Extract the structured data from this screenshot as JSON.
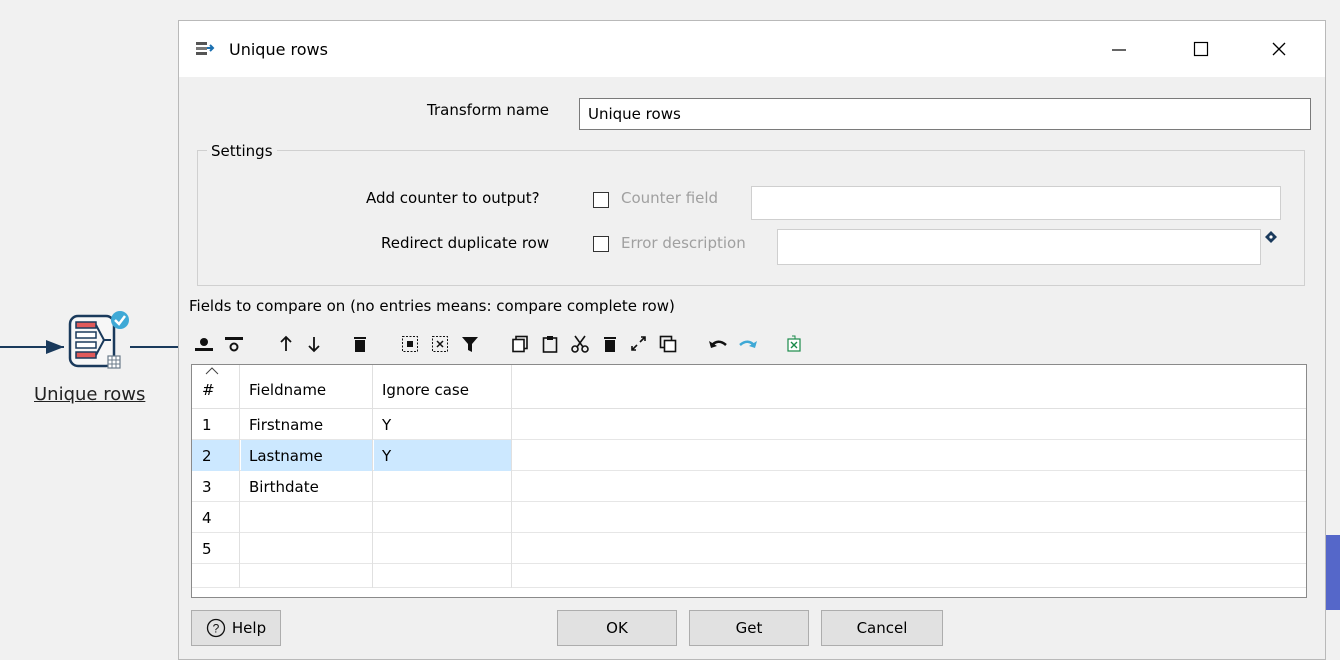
{
  "canvas": {
    "transform_label": "Unique rows"
  },
  "dialog": {
    "title": "Unique rows",
    "transform_name_label": "Transform name",
    "transform_name_value": "Unique rows",
    "settings": {
      "legend": "Settings",
      "add_counter_label": "Add counter to output?",
      "add_counter_checked": false,
      "counter_field_label": "Counter field",
      "counter_field_value": "",
      "redirect_duplicate_label": "Redirect duplicate row",
      "redirect_duplicate_checked": false,
      "error_description_label": "Error description",
      "error_description_value": ""
    },
    "fields_caption": "Fields to compare on (no entries means: compare complete row)",
    "toolbar": [
      "insert-row-icon",
      "delete-row-icon",
      "move-up-icon",
      "move-down-icon",
      "delete-icon",
      "select-all-icon",
      "clear-selection-icon",
      "filter-icon",
      "copy-icon",
      "paste-icon",
      "cut-icon",
      "delete-selected-icon",
      "expand-icon",
      "duplicate-icon",
      "undo-icon",
      "redo-icon",
      "export-icon"
    ],
    "table": {
      "columns": [
        "#",
        "Fieldname",
        "Ignore case"
      ],
      "rows": [
        {
          "num": "1",
          "fieldname": "Firstname",
          "ignore_case": "Y"
        },
        {
          "num": "2",
          "fieldname": "Lastname",
          "ignore_case": "Y"
        },
        {
          "num": "3",
          "fieldname": "Birthdate",
          "ignore_case": ""
        },
        {
          "num": "4",
          "fieldname": "",
          "ignore_case": ""
        },
        {
          "num": "5",
          "fieldname": "",
          "ignore_case": ""
        },
        {
          "num": "",
          "fieldname": "",
          "ignore_case": ""
        }
      ],
      "selected_row": 2
    },
    "buttons": {
      "help": "Help",
      "ok": "OK",
      "get": "Get",
      "cancel": "Cancel"
    }
  },
  "colors": {
    "selection": "#cce8ff",
    "hop": "#1a3a5c",
    "accent": "#5567c9"
  }
}
